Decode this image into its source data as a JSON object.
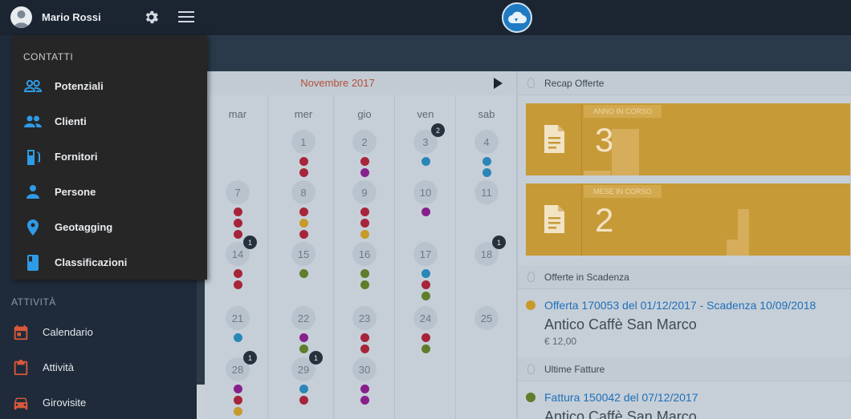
{
  "header": {
    "user_name": "Mario Rossi",
    "icons": [
      "avatar",
      "gear-icon",
      "menu-icon",
      "cloud-logo"
    ]
  },
  "sidebar": {
    "contatti_section": "CONTATTI",
    "contatti_items": [
      {
        "label": "Potenziali",
        "icon": "people-outline-icon"
      },
      {
        "label": "Clienti",
        "icon": "people-icon"
      },
      {
        "label": "Fornitori",
        "icon": "fuel-pump-icon"
      },
      {
        "label": "Persone",
        "icon": "person-icon"
      },
      {
        "label": "Geotagging",
        "icon": "location-pin-icon"
      },
      {
        "label": "Classificazioni",
        "icon": "book-icon"
      }
    ],
    "attivita_section": "ATTIVITÀ",
    "attivita_items": [
      {
        "label": "Calendario",
        "icon": "calendar-icon"
      },
      {
        "label": "Attività",
        "icon": "clipboard-icon"
      },
      {
        "label": "Girovisite",
        "icon": "car-icon"
      }
    ]
  },
  "calendar": {
    "month": "Novembre 2017",
    "weekdays": [
      "mar",
      "mer",
      "gio",
      "ven",
      "sab"
    ],
    "days": [
      {
        "n": "1",
        "col": 1,
        "row": 0,
        "badge": "",
        "dots": [
          "red",
          "red"
        ]
      },
      {
        "n": "2",
        "col": 2,
        "row": 0,
        "badge": "",
        "dots": [
          "red",
          "purple"
        ]
      },
      {
        "n": "3",
        "col": 3,
        "row": 0,
        "badge": "2",
        "dots": [
          "blue"
        ]
      },
      {
        "n": "4",
        "col": 4,
        "row": 0,
        "badge": "",
        "dots": [
          "blue",
          "blue"
        ]
      },
      {
        "n": "7",
        "col": 0,
        "row": 1,
        "badge": "",
        "dots": [
          "red",
          "red",
          "red"
        ]
      },
      {
        "n": "8",
        "col": 1,
        "row": 1,
        "badge": "",
        "dots": [
          "red",
          "yellow",
          "red"
        ]
      },
      {
        "n": "9",
        "col": 2,
        "row": 1,
        "badge": "",
        "dots": [
          "red",
          "red",
          "yellow"
        ]
      },
      {
        "n": "10",
        "col": 3,
        "row": 1,
        "badge": "",
        "dots": [
          "purple"
        ]
      },
      {
        "n": "11",
        "col": 4,
        "row": 1,
        "badge": "",
        "dots": []
      },
      {
        "n": "14",
        "col": 0,
        "row": 2,
        "badge": "1",
        "dots": [
          "red",
          "red"
        ]
      },
      {
        "n": "15",
        "col": 1,
        "row": 2,
        "badge": "",
        "dots": [
          "green"
        ]
      },
      {
        "n": "16",
        "col": 2,
        "row": 2,
        "badge": "",
        "dots": [
          "green",
          "green"
        ]
      },
      {
        "n": "17",
        "col": 3,
        "row": 2,
        "badge": "",
        "dots": [
          "blue",
          "red",
          "green"
        ]
      },
      {
        "n": "18",
        "col": 4,
        "row": 2,
        "badge": "1",
        "dots": []
      },
      {
        "n": "21",
        "col": 0,
        "row": 3,
        "badge": "",
        "dots": [
          "blue"
        ]
      },
      {
        "n": "22",
        "col": 1,
        "row": 3,
        "badge": "",
        "dots": [
          "purple",
          "green"
        ]
      },
      {
        "n": "23",
        "col": 2,
        "row": 3,
        "badge": "",
        "dots": [
          "red",
          "red"
        ]
      },
      {
        "n": "24",
        "col": 3,
        "row": 3,
        "badge": "",
        "dots": [
          "red",
          "green"
        ]
      },
      {
        "n": "25",
        "col": 4,
        "row": 3,
        "badge": "",
        "dots": []
      },
      {
        "n": "28",
        "col": 0,
        "row": 4,
        "badge": "1",
        "dots": [
          "purple",
          "red",
          "yellow"
        ]
      },
      {
        "n": "29",
        "col": 1,
        "row": 4,
        "badge": "1",
        "dots": [
          "blue",
          "red"
        ]
      },
      {
        "n": "30",
        "col": 2,
        "row": 4,
        "badge": "",
        "dots": [
          "purple",
          "purple"
        ]
      }
    ]
  },
  "colors": {
    "red": "#a6253a",
    "purple": "#87208c",
    "blue": "#2b86b8",
    "yellow": "#c79a2a",
    "green": "#5f7d2a",
    "kpi": "#c79a38",
    "link": "#1f6fb8"
  },
  "recap": {
    "title": "Recap Offerte",
    "anno_label": "ANNO IN CORSO",
    "anno_value": "3",
    "mese_label": "MESE IN CORSO",
    "mese_value": "2"
  },
  "scadenza": {
    "title": "Offerte in Scadenza",
    "item_title": "Offerta 170053 del 01/12/2017 - Scadenza 10/09/2018",
    "item_customer": "Antico Caffè San Marco",
    "item_amount": "€ 12,00"
  },
  "fatture": {
    "title": "Ultime Fatture",
    "item_title": "Fattura 150042 del 07/12/2017",
    "item_customer": "Antico Caffè San Marco"
  }
}
